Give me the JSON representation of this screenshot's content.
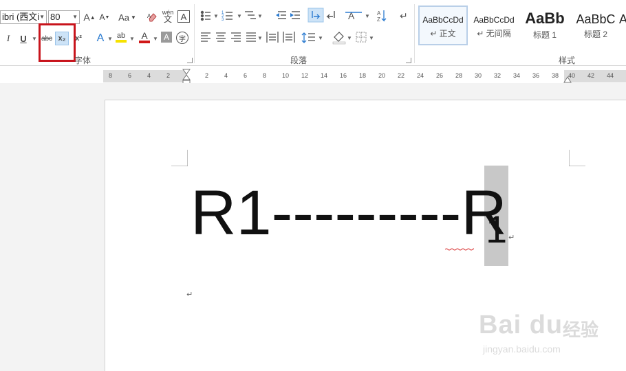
{
  "ribbon": {
    "font_group_label": "字体",
    "paragraph_group_label": "段落",
    "styles_group_label": "样式",
    "font_name": "ibri (西文i",
    "font_size": "80",
    "grow_font": "A",
    "shrink_font": "A",
    "change_case": "Aa",
    "phonetic_top": "wén",
    "phonetic_bottom": "文",
    "char_border": "A",
    "italic": "I",
    "underline": "U",
    "strike": "abc",
    "subscript": "x₂",
    "superscript": "x²",
    "text_effects": "A",
    "highlight": "ab",
    "font_color": "A",
    "char_shading": "A",
    "enclose": "字",
    "highlight_color": "#f6e200",
    "font_color_bar": "#d01818"
  },
  "styles": [
    {
      "sample": "AaBbCcDd",
      "name": "↵ 正文"
    },
    {
      "sample": "AaBbCcDd",
      "name": "↵ 无间隔"
    },
    {
      "sample": "AaBb",
      "name": "标题 1"
    },
    {
      "sample": "AaBbC",
      "name": "标题 2"
    },
    {
      "sample": "A",
      "name": ""
    }
  ],
  "ruler": {
    "ticks": [
      "8",
      "6",
      "4",
      "2",
      "2",
      "4",
      "6",
      "8",
      "10",
      "12",
      "14",
      "16",
      "18",
      "20",
      "22",
      "24",
      "26",
      "28",
      "30",
      "32",
      "34",
      "36",
      "38",
      "40",
      "42",
      "44"
    ]
  },
  "document": {
    "main_text": "R1---------R",
    "subscript_text": "1",
    "para_mark": "↵"
  },
  "watermark": {
    "logo": "Bai du",
    "cn": "经验",
    "url": "jingyan.baidu.com"
  },
  "colors": {
    "highlight_box": "#c8141c",
    "selection": "#c8c8c8",
    "squiggle": "#d83030"
  }
}
